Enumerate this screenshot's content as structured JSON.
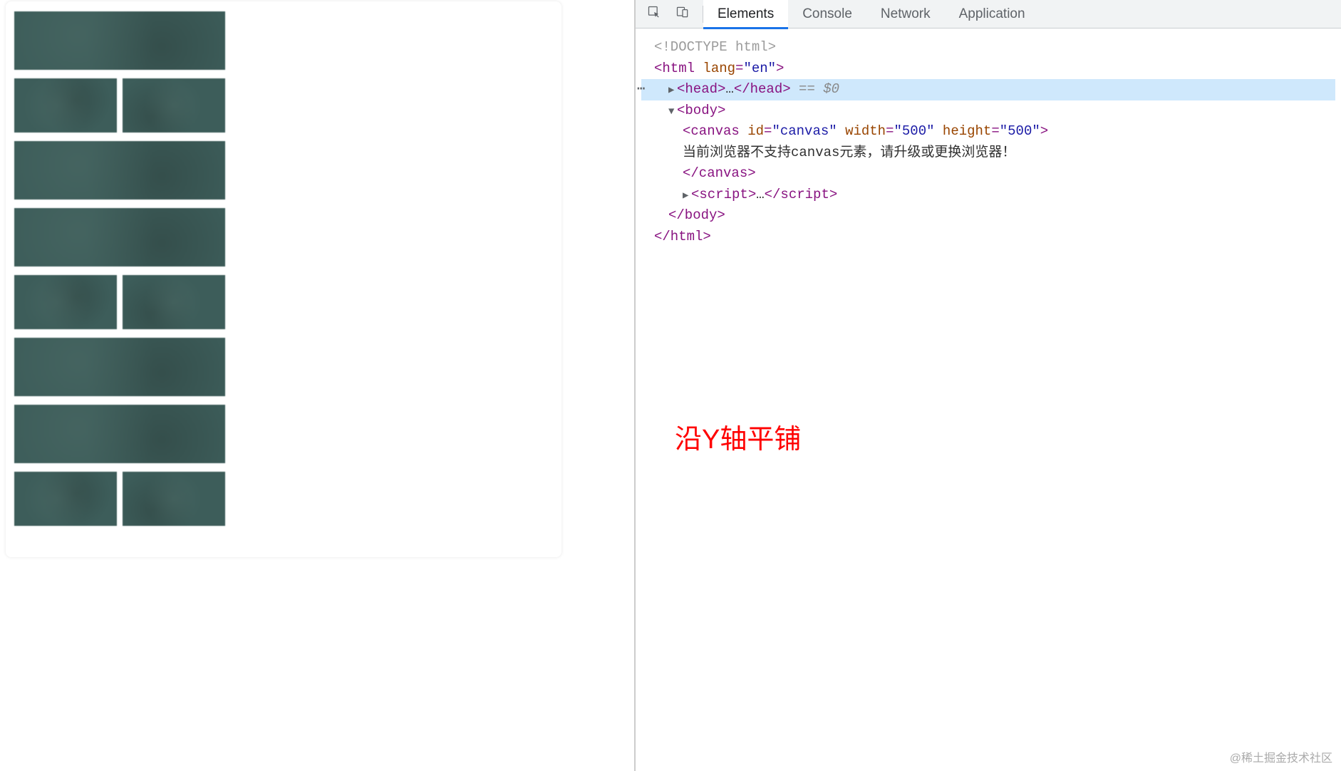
{
  "devtools": {
    "tabs": {
      "elements": "Elements",
      "console": "Console",
      "network": "Network",
      "application": "Application"
    }
  },
  "dom": {
    "doctype": "<!DOCTYPE html>",
    "html_open": "<html",
    "html_lang_attr": "lang",
    "html_lang_val": "\"en\"",
    "html_close_bracket": ">",
    "head_open": "<head>",
    "head_ellipsis": "…",
    "head_close": "</head>",
    "selected_marker_eq": " == ",
    "selected_marker_var": "$0",
    "body_open": "<body>",
    "canvas_open": "<canvas",
    "canvas_id_attr": "id",
    "canvas_id_val": "\"canvas\"",
    "canvas_width_attr": "width",
    "canvas_width_val": "\"500\"",
    "canvas_height_attr": "height",
    "canvas_height_val": "\"500\"",
    "canvas_close_bracket": ">",
    "canvas_text": "当前浏览器不支持canvas元素，请升级或更换浏览器！",
    "canvas_close": "</canvas>",
    "script_open": "<script>",
    "script_ellipsis": "…",
    "script_close": "</script>",
    "body_close": "</body>",
    "html_close": "</html>"
  },
  "annotation": "沿Y轴平铺",
  "watermark": "@稀土掘金技术社区"
}
